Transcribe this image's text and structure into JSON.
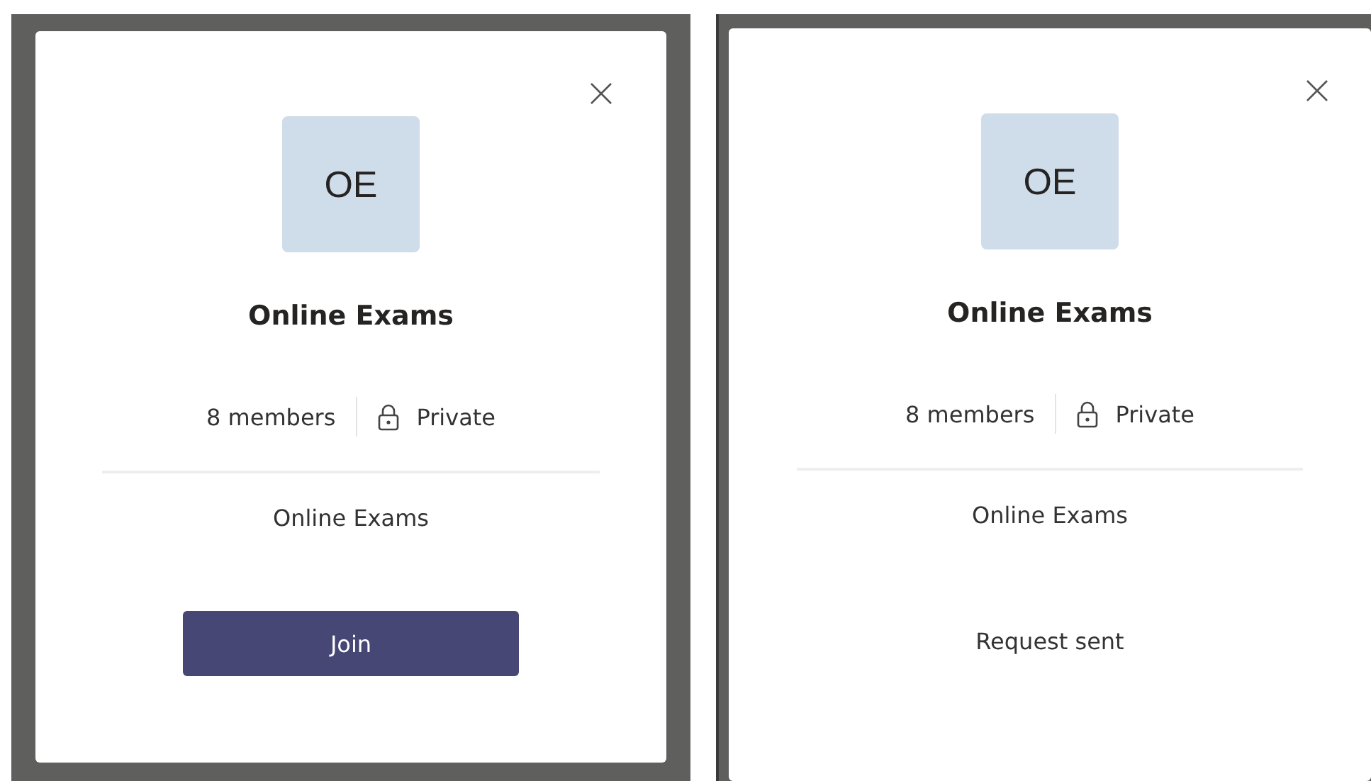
{
  "panels": [
    {
      "avatar": "OE",
      "title": "Online Exams",
      "members": "8 members",
      "privacy": "Private",
      "description": "Online Exams",
      "action": {
        "kind": "button",
        "label": "Join"
      }
    },
    {
      "avatar": "OE",
      "title": "Online Exams",
      "members": "8 members",
      "privacy": "Private",
      "description": "Online Exams",
      "action": {
        "kind": "status",
        "label": "Request sent"
      }
    }
  ]
}
